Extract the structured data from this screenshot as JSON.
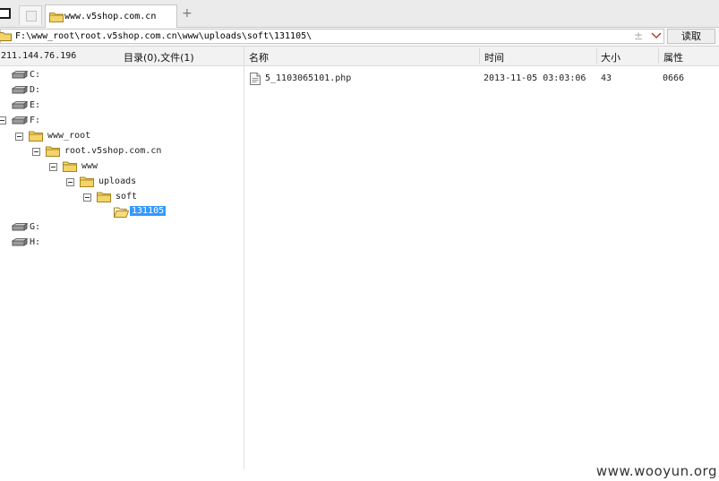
{
  "tabs": [
    {
      "label": ""
    },
    {
      "label": "www.v5shop.com.cn"
    }
  ],
  "address": {
    "path": "F:\\www_root\\root.v5shop.com.cn\\www\\uploads\\soft\\131105\\",
    "read_button": "读取"
  },
  "left_panel": {
    "ip": "211.144.76.196",
    "count": "目录(0),文件(1)"
  },
  "tree": {
    "drives": [
      "C:",
      "D:",
      "E:",
      "F:",
      "G:",
      "H:"
    ],
    "folders": [
      "www_root",
      "root.v5shop.com.cn",
      "www",
      "uploads",
      "soft",
      "131105"
    ]
  },
  "columns": [
    "名称",
    "时间",
    "大小",
    "属性"
  ],
  "files": [
    {
      "name": "5_1103065101.php",
      "time": "2013-11-05 03:03:06",
      "size": "43",
      "attr": "0666"
    }
  ],
  "watermark": "www.wooyun.org",
  "colors": {
    "selection": "#3399ff",
    "folder": "#f3d46a",
    "header_bg": "#f2f2f2"
  }
}
